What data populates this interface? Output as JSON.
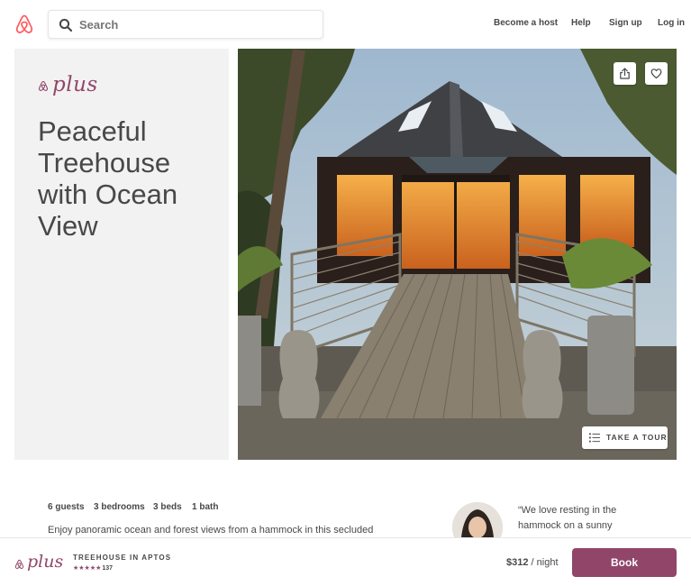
{
  "nav": {
    "search_placeholder": "Search",
    "links": [
      "Become a host",
      "Help",
      "Sign up",
      "Log in"
    ]
  },
  "hero": {
    "plus_brand": "plus",
    "title": "Peaceful Treehouse with Ocean View",
    "tour_label": "TAKE A TOUR"
  },
  "details": {
    "stats": [
      "6 guests",
      "3 bedrooms",
      "3 beds",
      "1 bath"
    ],
    "description": "Enjoy panoramic ocean and forest views from a hammock in this secluded",
    "host_quote": "“We love resting in the hammock on a sunny"
  },
  "bottom_bar": {
    "plus_brand": "plus",
    "listing_type": "TREEHOUSE IN APTOS",
    "stars": "★★★★★",
    "review_count": "137",
    "price": "$312",
    "price_unit": " / night",
    "book_label": "Book"
  },
  "colors": {
    "plus_accent": "#914669",
    "text": "#484848",
    "panel_bg": "#f2f2f2"
  },
  "icons": [
    "airbnb-logo-icon",
    "search-icon",
    "share-icon",
    "heart-icon",
    "list-icon"
  ]
}
